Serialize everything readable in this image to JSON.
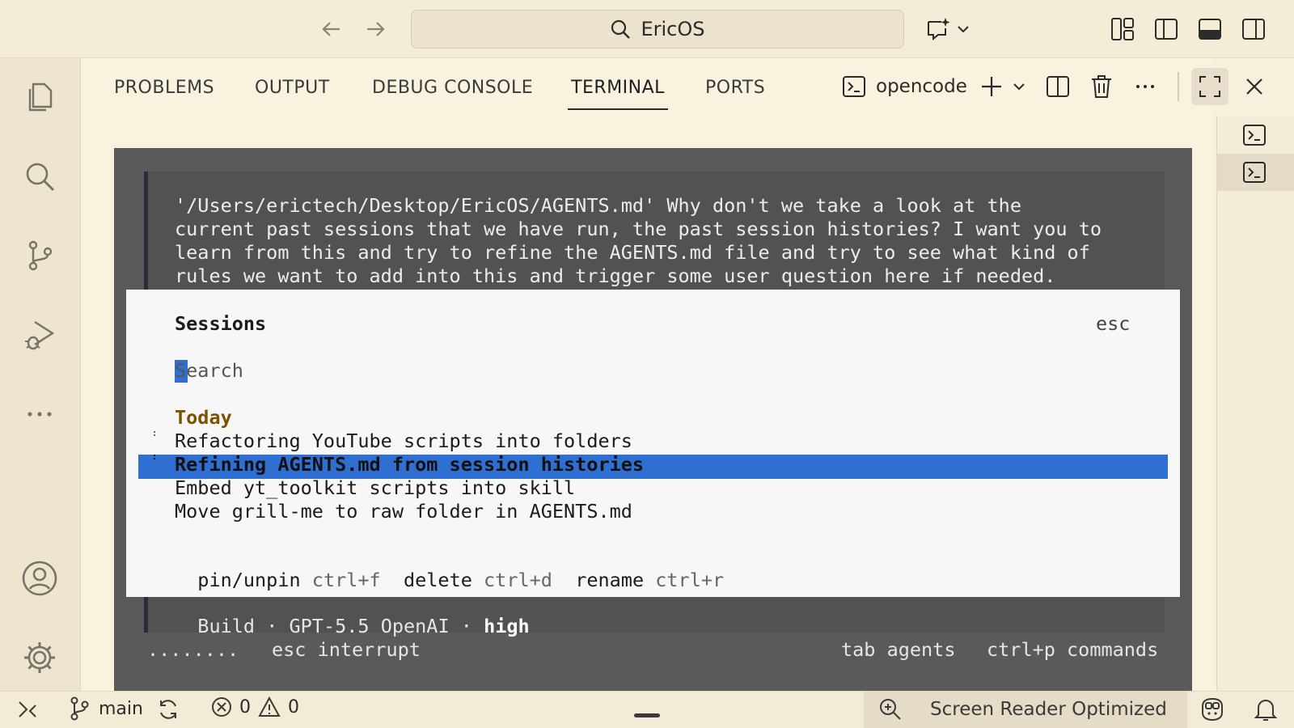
{
  "titlebar": {
    "search_text": "EricOS",
    "icons": [
      "arrow-left-icon",
      "arrow-right-icon",
      "search-icon",
      "chat-sparkle-icon",
      "chevron-down-icon",
      "layout-custom-icon",
      "toggle-primary-sidebar-icon",
      "toggle-panel-icon",
      "toggle-secondary-sidebar-icon"
    ]
  },
  "activitybar": {
    "items": [
      "explorer-icon",
      "search-icon",
      "source-control-icon",
      "run-debug-icon",
      "more-icon",
      "accounts-icon",
      "manage-gear-icon"
    ]
  },
  "panel": {
    "tabs": [
      {
        "label": "PROBLEMS",
        "active": false
      },
      {
        "label": "OUTPUT",
        "active": false
      },
      {
        "label": "DEBUG CONSOLE",
        "active": false
      },
      {
        "label": "TERMINAL",
        "active": true
      },
      {
        "label": "PORTS",
        "active": false
      }
    ],
    "terminal_name": "opencode"
  },
  "terminal": {
    "message_lines": [
      "'/Users/erictech/Desktop/EricOS/AGENTS.md' Why don't we take a look at the",
      "current past sessions that we have run, the past session histories? I want you to",
      "learn from this and try to refine the AGENTS.md file and try to see what kind of",
      "rules we want to add into this and trigger some user question here if needed."
    ],
    "dialog": {
      "title": "Sessions",
      "close_hint": "esc",
      "search_placeholder": "Search",
      "group_label": "Today",
      "sessions": [
        {
          "title": "Refactoring YouTube scripts into folders",
          "marker": "⠃",
          "selected": false
        },
        {
          "title": "Refining AGENTS.md from session histories",
          "marker": "⠃",
          "selected": true
        },
        {
          "title": "Embed yt_toolkit scripts into skill",
          "marker": "",
          "selected": false
        },
        {
          "title": "Move grill-me to raw folder in AGENTS.md",
          "marker": "",
          "selected": false
        }
      ],
      "shortcuts": [
        {
          "action": "pin/unpin",
          "key": "ctrl+f"
        },
        {
          "action": "delete",
          "key": "ctrl+d"
        },
        {
          "action": "rename",
          "key": "ctrl+r"
        }
      ]
    },
    "build_line": {
      "mode": "Build",
      "sep": "·",
      "model": "GPT-5.5 OpenAI",
      "effort": "high"
    },
    "footer": {
      "spinner": "........",
      "interrupt": "esc interrupt",
      "agents": "tab agents",
      "commands": "ctrl+p commands"
    }
  },
  "statusbar": {
    "branch": "main",
    "errors": "0",
    "warnings": "0",
    "screen_reader": "Screen Reader Optimized"
  },
  "colors": {
    "accent": "#2f6fd1",
    "today": "#7a5200",
    "terminal_bg": "#5a5a5a"
  }
}
